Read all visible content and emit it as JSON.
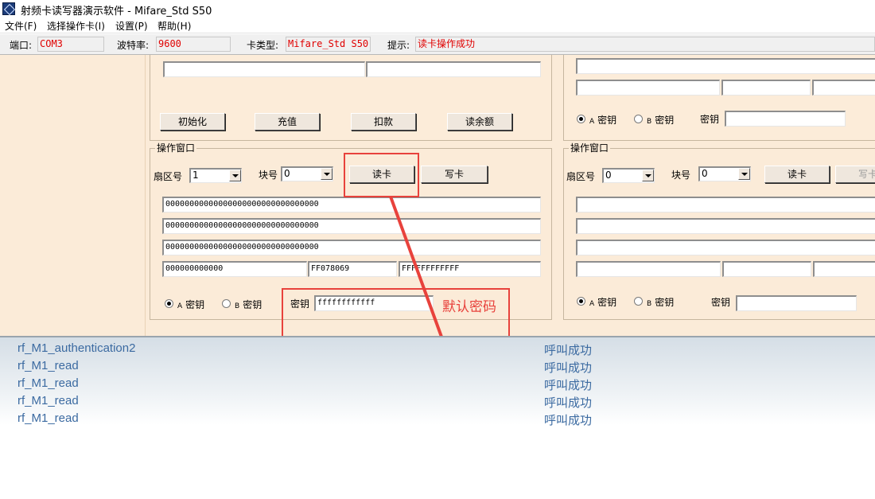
{
  "window": {
    "title": "射频卡读写器演示软件  -  Mifare_Std S50"
  },
  "menu": {
    "items": [
      "文件(F)",
      "选择操作卡(I)",
      "设置(P)",
      "帮助(H)"
    ]
  },
  "status": {
    "port_label": "端口:",
    "port_value": "COM3",
    "baud_label": "波特率:",
    "baud_value": "9600",
    "cardtype_label": "卡类型:",
    "cardtype_value": "Mifare_Std S50",
    "hint_label": "提示:",
    "hint_value": "读卡操作成功"
  },
  "wallet_panel": {
    "buttons": {
      "init": "初始化",
      "recharge": "充值",
      "deduct": "扣款",
      "balance": "读余额"
    }
  },
  "left_op": {
    "title": "操作窗口",
    "sector_label": "扇区号",
    "sector_value": "1",
    "block_label": "块号",
    "block_value": "0",
    "read_button": "读卡",
    "write_button": "写卡",
    "data_rows": [
      "00000000000000000000000000000000",
      "00000000000000000000000000000000",
      "00000000000000000000000000000000"
    ],
    "trailer": [
      "000000000000",
      "FF078069",
      "FFFFFFFFFFFF"
    ],
    "radio_a_letter": "A",
    "radio_a_label": "密钥",
    "radio_b_letter": "B",
    "radio_b_label": "密钥",
    "key_label": "密钥",
    "key_value": "ffffffffffff"
  },
  "right_top": {
    "radio_a_letter": "A",
    "radio_a_label": "密钥",
    "radio_b_letter": "B",
    "radio_b_label": "密钥",
    "key_label": "密钥"
  },
  "right_op": {
    "title": "操作窗口",
    "sector_label": "扇区号",
    "sector_value": "0",
    "block_label": "块号",
    "block_value": "0",
    "read_button": "读卡",
    "write_button": "写卡",
    "radio_a_letter": "A",
    "radio_a_label": "密钥",
    "radio_b_letter": "B",
    "radio_b_label": "密钥",
    "key_label": "密钥"
  },
  "annotation": {
    "text": "默认密码",
    "color": "#e8423c"
  },
  "log": {
    "entries": [
      {
        "fn": "rf_M1_authentication2",
        "result": "呼叫成功"
      },
      {
        "fn": "rf_M1_read",
        "result": "呼叫成功"
      },
      {
        "fn": "rf_M1_read",
        "result": "呼叫成功"
      },
      {
        "fn": "rf_M1_read",
        "result": "呼叫成功"
      },
      {
        "fn": "rf_M1_read",
        "result": "呼叫成功"
      }
    ]
  }
}
